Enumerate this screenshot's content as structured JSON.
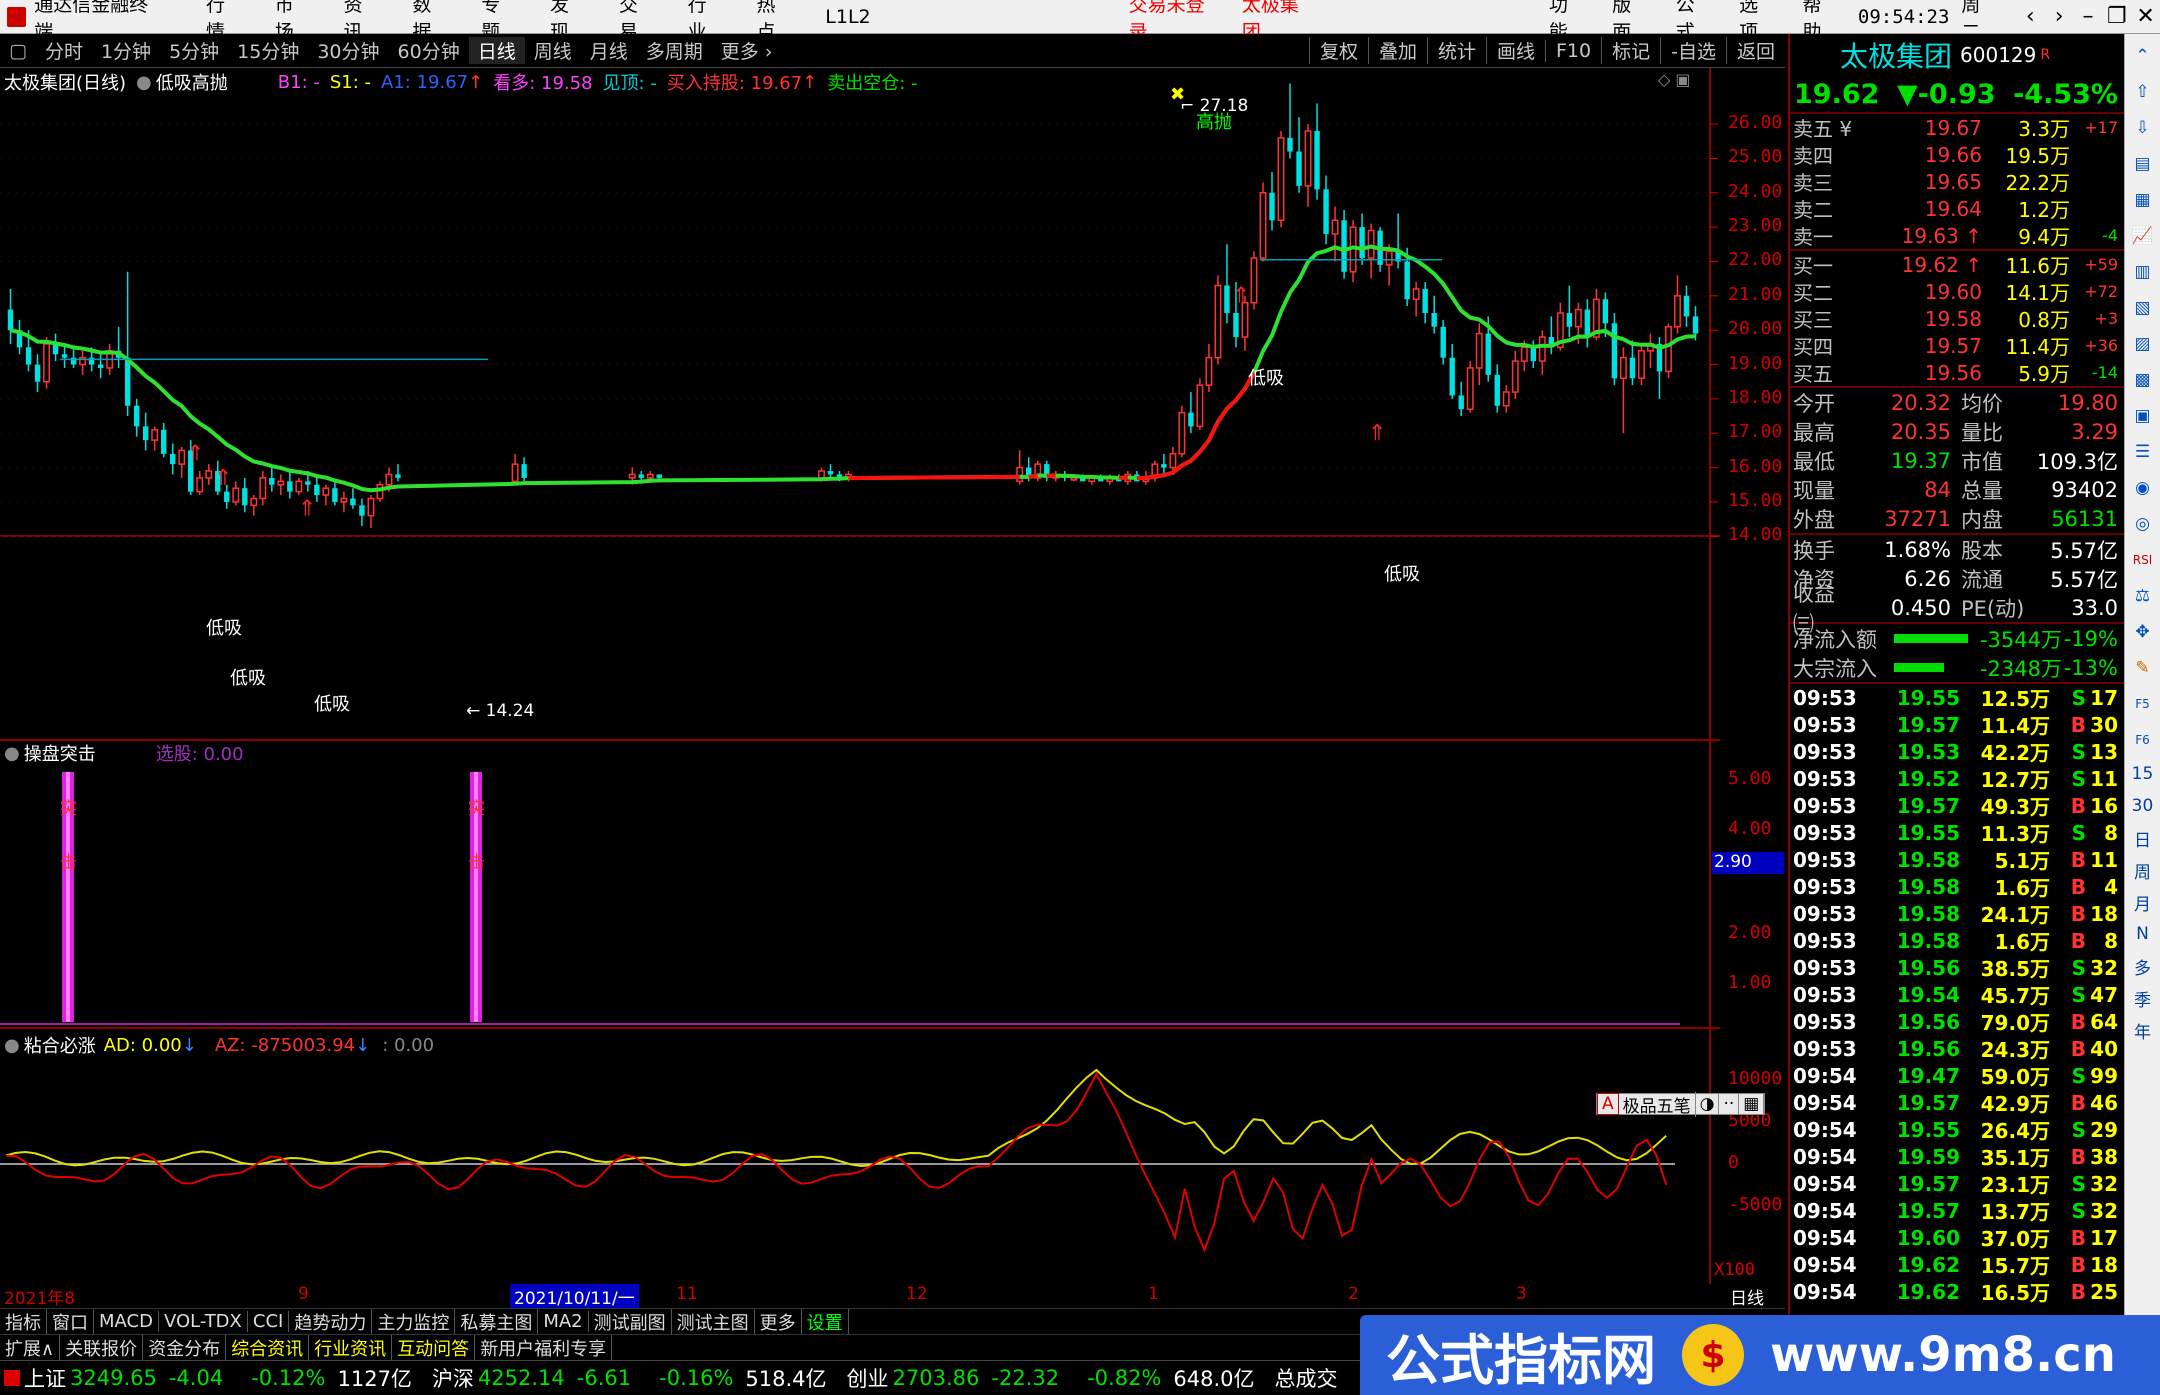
{
  "topbar": {
    "app_title": "通达信金融终端",
    "menus": [
      "行情",
      "市场",
      "资讯",
      "数据",
      "专题",
      "发现",
      "交易",
      "行业",
      "热点",
      "L1L2"
    ],
    "login_status": "交易未登录",
    "stock_name": "太极集团",
    "right_menus": [
      "功能",
      "版面",
      "公式",
      "选项",
      "帮助"
    ],
    "time": "09:54:23",
    "weekday": "周二"
  },
  "periods": [
    "分时",
    "1分钟",
    "5分钟",
    "15分钟",
    "30分钟",
    "60分钟",
    "日线",
    "周线",
    "月线",
    "多周期",
    "更多 ›"
  ],
  "active_period": "日线",
  "tools": [
    "复权",
    "叠加",
    "统计",
    "画线",
    "F10",
    "标记",
    "-自选",
    "返回"
  ],
  "chart_info": {
    "name": "太极集团(日线)",
    "formula": "低吸高抛",
    "b1": "B1: -",
    "s1": "S1: -",
    "a1": "A1: 19.67",
    "look_up": "看多: 19.58",
    "peak": "见顶: -",
    "buy_hold": "买入持股: 19.67",
    "sell_empty": "卖出空仓: -"
  },
  "main_axis": [
    "26.00",
    "25.00",
    "24.00",
    "23.00",
    "22.00",
    "21.00",
    "20.00",
    "19.00",
    "18.00",
    "17.00",
    "16.00",
    "15.00",
    "14.00"
  ],
  "annotations": {
    "high": "27.18",
    "low": "14.24",
    "sell_mark": "高抛",
    "buy_mark": "低吸"
  },
  "sub1": {
    "name": "操盘突击",
    "label": "选股: 0.00",
    "bar_text": [
      "突",
      "击"
    ],
    "axis": [
      "5.00",
      "4.00",
      "2.00",
      "1.00"
    ],
    "cursor_value": "2.90"
  },
  "sub2": {
    "name": "粘合必涨",
    "ad": "AD: 0.00",
    "az": "AZ: -875003.94",
    "other": ": 0.00",
    "axis": [
      "10000",
      "5000",
      "0",
      "-5000"
    ],
    "scale": "X100",
    "toolbox": [
      "A",
      "极品五笔",
      "◑",
      "··",
      "▦"
    ]
  },
  "dates": {
    "labels": [
      "2021年8",
      "9",
      "11",
      "12",
      "1",
      "2",
      "3"
    ],
    "cursor_date": "2021/10/11/一",
    "period_label": "日线"
  },
  "indicator_tabs": [
    "指标",
    "窗口",
    "MACD",
    "VOL-TDX",
    "CCI",
    "趋势动力",
    "主力监控",
    "私募主图",
    "MA2",
    "测试副图",
    "测试主图",
    "更多",
    "设置"
  ],
  "ext_tabs": [
    "扩展∧",
    "关联报价",
    "资金分布",
    "综合资讯",
    "行业资讯",
    "互动问答",
    "新用户福利专享"
  ],
  "quote": {
    "name": "太极集团",
    "code": "600129",
    "badge": "R",
    "price": "19.62",
    "change": "▼-0.93",
    "change_pct": "-4.53%"
  },
  "sells": [
    {
      "label": "卖五 ¥",
      "price": "19.67",
      "vol": "3.3万",
      "chg": "+17"
    },
    {
      "label": "卖四",
      "price": "19.66",
      "vol": "19.5万",
      "chg": ""
    },
    {
      "label": "卖三",
      "price": "19.65",
      "vol": "22.2万",
      "chg": ""
    },
    {
      "label": "卖二",
      "price": "19.64",
      "vol": "1.2万",
      "chg": ""
    },
    {
      "label": "卖一",
      "price": "19.63 ↑",
      "vol": "9.4万",
      "chg": "-4"
    }
  ],
  "buys": [
    {
      "label": "买一",
      "price": "19.62 ↑",
      "vol": "11.6万",
      "chg": "+59"
    },
    {
      "label": "买二",
      "price": "19.60",
      "vol": "14.1万",
      "chg": "+72"
    },
    {
      "label": "买三",
      "price": "19.58",
      "vol": "0.8万",
      "chg": "+3"
    },
    {
      "label": "买四",
      "price": "19.57",
      "vol": "11.4万",
      "chg": "+36"
    },
    {
      "label": "买五",
      "price": "19.56",
      "vol": "5.9万",
      "chg": "-14"
    }
  ],
  "stats": [
    {
      "k": "今开",
      "v": "20.32",
      "k2": "均价",
      "v2": "19.80"
    },
    {
      "k": "最高",
      "v": "20.35",
      "k2": "量比",
      "v2": "3.29"
    },
    {
      "k": "最低",
      "v": "19.37",
      "k2": "市值",
      "v2": "109.3亿"
    },
    {
      "k": "现量",
      "v": "84",
      "k2": "总量",
      "v2": "93402"
    },
    {
      "k": "外盘",
      "v": "37271",
      "k2": "内盘",
      "v2": "56131"
    }
  ],
  "stats2": [
    {
      "k": "换手",
      "v": "1.68%",
      "k2": "股本",
      "v2": "5.57亿"
    },
    {
      "k": "净资",
      "v": "6.26",
      "k2": "流通",
      "v2": "5.57亿"
    },
    {
      "k": "收益㈢",
      "v": "0.450",
      "k2": "PE(动)",
      "v2": "33.0"
    }
  ],
  "flows": [
    {
      "k": "净流入额",
      "v": "-3544万",
      "pc": "-19%",
      "bar": 0.62
    },
    {
      "k": "大宗流入",
      "v": "-2348万",
      "pc": "-13%",
      "bar": 0.42
    }
  ],
  "ticks": [
    {
      "t": "09:53",
      "p": "19.55",
      "v": "12.5万",
      "d": "S",
      "n": "17"
    },
    {
      "t": "09:53",
      "p": "19.57",
      "v": "11.4万",
      "d": "B",
      "n": "30"
    },
    {
      "t": "09:53",
      "p": "19.53",
      "v": "42.2万",
      "d": "S",
      "n": "13"
    },
    {
      "t": "09:53",
      "p": "19.52",
      "v": "12.7万",
      "d": "S",
      "n": "11"
    },
    {
      "t": "09:53",
      "p": "19.57",
      "v": "49.3万",
      "d": "B",
      "n": "16"
    },
    {
      "t": "09:53",
      "p": "19.55",
      "v": "11.3万",
      "d": "S",
      "n": "8"
    },
    {
      "t": "09:53",
      "p": "19.58",
      "v": "5.1万",
      "d": "B",
      "n": "11"
    },
    {
      "t": "09:53",
      "p": "19.58",
      "v": "1.6万",
      "d": "B",
      "n": "4"
    },
    {
      "t": "09:53",
      "p": "19.58",
      "v": "24.1万",
      "d": "B",
      "n": "18"
    },
    {
      "t": "09:53",
      "p": "19.58",
      "v": "1.6万",
      "d": "B",
      "n": "8"
    },
    {
      "t": "09:53",
      "p": "19.56",
      "v": "38.5万",
      "d": "S",
      "n": "32"
    },
    {
      "t": "09:53",
      "p": "19.54",
      "v": "45.7万",
      "d": "S",
      "n": "47"
    },
    {
      "t": "09:53",
      "p": "19.56",
      "v": "79.0万",
      "d": "B",
      "n": "64"
    },
    {
      "t": "09:53",
      "p": "19.56",
      "v": "24.3万",
      "d": "B",
      "n": "40"
    },
    {
      "t": "09:54",
      "p": "19.47",
      "v": "59.0万",
      "d": "S",
      "n": "99"
    },
    {
      "t": "09:54",
      "p": "19.57",
      "v": "42.9万",
      "d": "B",
      "n": "46"
    },
    {
      "t": "09:54",
      "p": "19.55",
      "v": "26.4万",
      "d": "S",
      "n": "29"
    },
    {
      "t": "09:54",
      "p": "19.59",
      "v": "35.1万",
      "d": "B",
      "n": "38"
    },
    {
      "t": "09:54",
      "p": "19.57",
      "v": "23.1万",
      "d": "S",
      "n": "32"
    },
    {
      "t": "09:54",
      "p": "19.57",
      "v": "13.7万",
      "d": "S",
      "n": "32"
    },
    {
      "t": "09:54",
      "p": "19.60",
      "v": "37.0万",
      "d": "B",
      "n": "17"
    },
    {
      "t": "09:54",
      "p": "19.62",
      "v": "15.7万",
      "d": "B",
      "n": "18"
    },
    {
      "t": "09:54",
      "p": "19.62",
      "v": "16.5万",
      "d": "B",
      "n": "25"
    }
  ],
  "sidebar_text": [
    "日",
    "周",
    "月",
    "N",
    "多",
    "季",
    "年"
  ],
  "sidebar_labels": [
    "RSI",
    "F5",
    "F6",
    "15",
    "30"
  ],
  "status": {
    "sh_name": "上证",
    "sh_val": "3249.65",
    "sh_chg": "-4.04",
    "sh_pct": "-0.12%",
    "sh_amt": "1127亿",
    "sz_name": "沪深",
    "sz_val": "4252.14",
    "sz_chg": "-6.61",
    "sz_pct": "-0.16%",
    "sz_amt": "518.4亿",
    "cy_name": "创业",
    "cy_val": "2703.86",
    "cy_chg": "-22.32",
    "cy_pct": "-0.82%",
    "cy_amt": "648.0亿",
    "total": "总成交"
  },
  "watermark": {
    "text": "公式指标网",
    "coin": "$",
    "url": "www.9m8.cn"
  },
  "colors": {
    "up": "#ff3333",
    "down": "#00e000",
    "ma_down": "#30e030",
    "ma_up": "#ff1010",
    "axis": "#d00000"
  },
  "chart_data": {
    "type": "candlestick",
    "price_axis_range": [
      14.0,
      26.0
    ],
    "ohlc_note": "daily candles 2021-08 to 2022-03, high 27.18, low 14.24",
    "candles": [
      [
        20.6,
        21.2,
        19.6,
        20.0
      ],
      [
        20.0,
        20.3,
        19.3,
        19.5
      ],
      [
        19.5,
        20.0,
        18.8,
        19.0
      ],
      [
        19.0,
        19.3,
        18.2,
        18.5
      ],
      [
        18.5,
        19.8,
        18.3,
        19.6
      ],
      [
        19.6,
        19.9,
        19.1,
        19.3
      ],
      [
        19.3,
        19.6,
        18.9,
        19.2
      ],
      [
        19.2,
        19.5,
        18.9,
        19.0
      ],
      [
        19.0,
        19.4,
        18.7,
        19.2
      ],
      [
        19.2,
        19.5,
        18.8,
        19.0
      ],
      [
        19.0,
        19.3,
        18.6,
        18.9
      ],
      [
        18.9,
        19.6,
        18.7,
        19.4
      ],
      [
        19.4,
        20.1,
        18.9,
        19.2
      ],
      [
        19.2,
        21.7,
        17.5,
        17.8
      ],
      [
        17.8,
        18.0,
        16.9,
        17.2
      ],
      [
        17.2,
        17.6,
        16.5,
        16.8
      ],
      [
        16.8,
        17.2,
        16.5,
        17.1
      ],
      [
        17.1,
        17.3,
        16.3,
        16.4
      ],
      [
        16.4,
        16.7,
        15.8,
        16.1
      ],
      [
        16.1,
        16.6,
        15.7,
        16.5
      ],
      [
        16.5,
        16.8,
        15.2,
        15.3
      ],
      [
        15.3,
        15.9,
        15.2,
        15.7
      ],
      [
        15.7,
        16.1,
        15.5,
        15.9
      ],
      [
        15.9,
        16.2,
        15.2,
        15.3
      ],
      [
        15.3,
        15.5,
        14.8,
        15.0
      ],
      [
        15.0,
        15.6,
        14.9,
        15.4
      ],
      [
        15.4,
        15.7,
        14.7,
        14.9
      ],
      [
        14.9,
        15.2,
        14.6,
        15.1
      ],
      [
        15.1,
        15.9,
        14.9,
        15.7
      ],
      [
        15.7,
        16.0,
        15.3,
        15.5
      ],
      [
        15.5,
        15.8,
        15.2,
        15.6
      ],
      [
        15.6,
        15.9,
        15.1,
        15.3
      ],
      [
        15.3,
        15.7,
        15.2,
        15.6
      ],
      [
        15.6,
        15.9,
        15.3,
        15.5
      ],
      [
        15.5,
        15.7,
        15.0,
        15.2
      ],
      [
        15.2,
        15.5,
        14.9,
        15.4
      ],
      [
        15.4,
        15.6,
        14.9,
        15.0
      ],
      [
        15.0,
        15.3,
        14.7,
        15.1
      ],
      [
        15.1,
        15.4,
        14.8,
        14.9
      ],
      [
        14.9,
        15.1,
        14.3,
        14.6
      ],
      [
        14.6,
        15.2,
        14.24,
        15.1
      ],
      [
        15.1,
        15.6,
        15.0,
        15.5
      ],
      [
        15.5,
        16.0,
        15.3,
        15.8
      ],
      [
        15.8,
        16.1,
        15.6,
        15.7
      ],
      null,
      null,
      null,
      null,
      null,
      null,
      null,
      null,
      null,
      null,
      null,
      null,
      [
        15.6,
        16.4,
        15.5,
        16.1
      ],
      [
        16.1,
        16.3,
        15.6,
        15.7
      ],
      null,
      null,
      null,
      null,
      null,
      null,
      null,
      null,
      null,
      null,
      null,
      [
        15.7,
        16.0,
        15.5,
        15.8
      ],
      [
        15.8,
        15.9,
        15.6,
        15.7
      ],
      [
        15.7,
        15.9,
        15.6,
        15.8
      ],
      [
        15.8,
        15.8,
        15.6,
        15.7
      ],
      null,
      null,
      null,
      null,
      null,
      null,
      null,
      null,
      null,
      null,
      null,
      null,
      null,
      null,
      null,
      null,
      null,
      [
        15.7,
        16.0,
        15.6,
        15.9
      ],
      [
        15.9,
        16.1,
        15.7,
        15.8
      ],
      [
        15.8,
        15.9,
        15.6,
        15.7
      ],
      [
        15.7,
        15.9,
        15.6,
        15.8
      ],
      null,
      null,
      null,
      null,
      null,
      null,
      null,
      null,
      null,
      null,
      null,
      null,
      null,
      null,
      null,
      null,
      null,
      null,
      [
        15.6,
        16.5,
        15.5,
        16.0
      ],
      [
        16.0,
        16.3,
        15.6,
        15.7
      ],
      [
        15.7,
        16.2,
        15.6,
        16.1
      ],
      [
        16.1,
        16.2,
        15.6,
        15.7
      ],
      [
        15.7,
        15.9,
        15.6,
        15.8
      ],
      [
        15.8,
        15.9,
        15.6,
        15.7
      ],
      [
        15.7,
        15.8,
        15.6,
        15.7
      ],
      [
        15.7,
        15.8,
        15.6,
        15.6
      ],
      [
        15.6,
        15.7,
        15.5,
        15.7
      ],
      [
        15.7,
        15.8,
        15.6,
        15.6
      ],
      [
        15.6,
        15.8,
        15.5,
        15.7
      ],
      [
        15.7,
        15.8,
        15.6,
        15.6
      ],
      [
        15.6,
        15.9,
        15.5,
        15.8
      ],
      [
        15.8,
        15.9,
        15.6,
        15.6
      ],
      [
        15.6,
        15.9,
        15.5,
        15.7
      ],
      [
        15.7,
        16.2,
        15.6,
        16.1
      ],
      [
        16.1,
        16.4,
        15.8,
        16.0
      ],
      [
        16.0,
        16.6,
        15.8,
        16.4
      ],
      [
        16.4,
        17.8,
        16.3,
        17.6
      ],
      [
        17.6,
        18.2,
        17.0,
        17.2
      ],
      [
        17.2,
        18.6,
        17.1,
        18.4
      ],
      [
        18.4,
        19.6,
        18.2,
        19.2
      ],
      [
        19.2,
        21.6,
        19.0,
        21.3
      ],
      [
        21.3,
        22.5,
        20.2,
        20.5
      ],
      [
        20.5,
        21.4,
        19.5,
        19.8
      ],
      [
        19.8,
        21.0,
        19.4,
        20.8
      ],
      [
        20.8,
        22.3,
        20.6,
        22.1
      ],
      [
        22.1,
        24.3,
        22.0,
        24.0
      ],
      [
        24.0,
        24.6,
        22.9,
        23.2
      ],
      [
        23.2,
        25.8,
        23.0,
        25.6
      ],
      [
        25.6,
        27.18,
        25.0,
        25.2
      ],
      [
        25.2,
        26.2,
        24.0,
        24.2
      ],
      [
        24.2,
        26.0,
        23.6,
        25.8
      ],
      [
        25.8,
        26.6,
        23.8,
        24.1
      ],
      [
        24.1,
        24.5,
        22.5,
        22.8
      ],
      [
        22.8,
        23.6,
        22.0,
        23.2
      ],
      [
        23.2,
        23.5,
        21.5,
        21.7
      ],
      [
        21.7,
        23.2,
        21.4,
        23.0
      ],
      [
        23.0,
        23.4,
        21.9,
        22.1
      ],
      [
        22.1,
        23.1,
        21.5,
        22.9
      ],
      [
        22.9,
        23.0,
        21.7,
        21.9
      ],
      [
        21.9,
        22.5,
        21.3,
        22.3
      ],
      [
        22.3,
        23.4,
        21.8,
        22.0
      ],
      [
        22.0,
        22.4,
        20.7,
        20.9
      ],
      [
        20.9,
        21.4,
        20.4,
        21.2
      ],
      [
        21.2,
        21.4,
        20.2,
        20.5
      ],
      [
        20.5,
        21.0,
        19.9,
        20.1
      ],
      [
        20.1,
        20.3,
        19.0,
        19.2
      ],
      [
        19.2,
        19.6,
        18.0,
        18.1
      ],
      [
        18.1,
        18.5,
        17.5,
        17.7
      ],
      [
        17.7,
        19.1,
        17.6,
        18.9
      ],
      [
        18.9,
        20.2,
        18.4,
        19.9
      ],
      [
        19.9,
        20.4,
        18.5,
        18.7
      ],
      [
        18.7,
        19.0,
        17.6,
        17.8
      ],
      [
        17.8,
        18.4,
        17.6,
        18.2
      ],
      [
        18.2,
        19.4,
        18.0,
        19.1
      ],
      [
        19.1,
        19.7,
        18.8,
        19.5
      ],
      [
        19.5,
        19.7,
        18.9,
        19.1
      ],
      [
        19.1,
        20.0,
        18.7,
        19.8
      ],
      [
        19.8,
        20.4,
        19.3,
        19.5
      ],
      [
        19.5,
        20.8,
        19.4,
        20.5
      ],
      [
        20.5,
        21.3,
        19.8,
        20.1
      ],
      [
        20.1,
        20.8,
        19.6,
        20.6
      ],
      [
        20.6,
        20.9,
        19.5,
        19.8
      ],
      [
        19.8,
        21.2,
        19.7,
        20.9
      ],
      [
        20.9,
        21.1,
        19.8,
        20.2
      ],
      [
        20.2,
        20.5,
        18.4,
        18.6
      ],
      [
        18.6,
        19.5,
        17.0,
        19.2
      ],
      [
        19.2,
        19.7,
        18.4,
        18.6
      ],
      [
        18.6,
        19.6,
        18.4,
        19.4
      ],
      [
        19.4,
        19.9,
        18.9,
        19.6
      ],
      [
        19.6,
        19.8,
        18.0,
        18.8
      ],
      [
        18.8,
        20.2,
        18.6,
        20.1
      ],
      [
        20.1,
        21.6,
        19.9,
        21.0
      ],
      [
        21.0,
        21.3,
        20.1,
        20.4
      ],
      [
        20.4,
        20.7,
        19.7,
        19.9
      ]
    ]
  }
}
